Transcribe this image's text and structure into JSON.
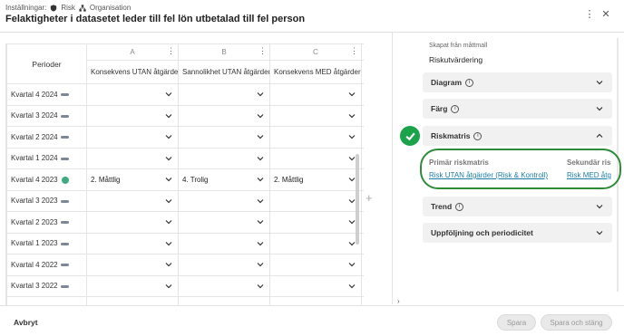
{
  "header": {
    "settings_label": "Inställningar:",
    "crumb1": "Risk",
    "crumb2": "Organisation",
    "title": "Felaktigheter i datasetet leder till fel lön utbetalad till fel person",
    "more_icon": "vertical-ellipsis-icon",
    "close_icon": "close-icon"
  },
  "grid": {
    "corner_label": "Perioder",
    "columns": [
      {
        "letter": "A",
        "name": "Konsekvens UTAN åtgärder"
      },
      {
        "letter": "B",
        "name": "Sannolikhet UTAN åtgärder"
      },
      {
        "letter": "C",
        "name": "Konsekvens MED åtgärder"
      }
    ],
    "rows": [
      {
        "period": "Kvartal 4 2024",
        "a": "",
        "b": "",
        "c": ""
      },
      {
        "period": "Kvartal 3 2024",
        "a": "",
        "b": "",
        "c": ""
      },
      {
        "period": "Kvartal 2 2024",
        "a": "",
        "b": "",
        "c": ""
      },
      {
        "period": "Kvartal 1 2024",
        "a": "",
        "b": "",
        "c": ""
      },
      {
        "period": "Kvartal 4 2023",
        "a": "2. Måttlig",
        "b": "4. Trolig",
        "c": "2. Måttlig"
      },
      {
        "period": "Kvartal 3 2023",
        "a": "",
        "b": "",
        "c": ""
      },
      {
        "period": "Kvartal 2 2023",
        "a": "",
        "b": "",
        "c": ""
      },
      {
        "period": "Kvartal 1 2023",
        "a": "",
        "b": "",
        "c": ""
      },
      {
        "period": "Kvartal 4 2022",
        "a": "",
        "b": "",
        "c": ""
      },
      {
        "period": "Kvartal 3 2022",
        "a": "",
        "b": "",
        "c": ""
      },
      {
        "period": "",
        "a": "",
        "b": "",
        "c": ""
      }
    ]
  },
  "right": {
    "made_from": "Skapat från måttmall",
    "template_name": "Riskutvärdering",
    "sections": {
      "diagram": "Diagram",
      "farg": "Färg",
      "riskmatris": "Riskmatris",
      "trend": "Trend",
      "uppfoljning": "Uppföljning och periodicitet"
    },
    "primary_label": "Primär riskmatris",
    "secondary_label": "Sekundär ris",
    "primary_link": "Risk UTAN åtgärder (Risk & Kontroll)",
    "secondary_link": "Risk MED åtg"
  },
  "footer": {
    "cancel": "Avbryt",
    "save": "Spara",
    "save_close": "Spara och stäng"
  },
  "colors": {
    "accent_green": "#1aa34a",
    "link_blue": "#1a7fa8",
    "status_dot": "#3daa82"
  }
}
